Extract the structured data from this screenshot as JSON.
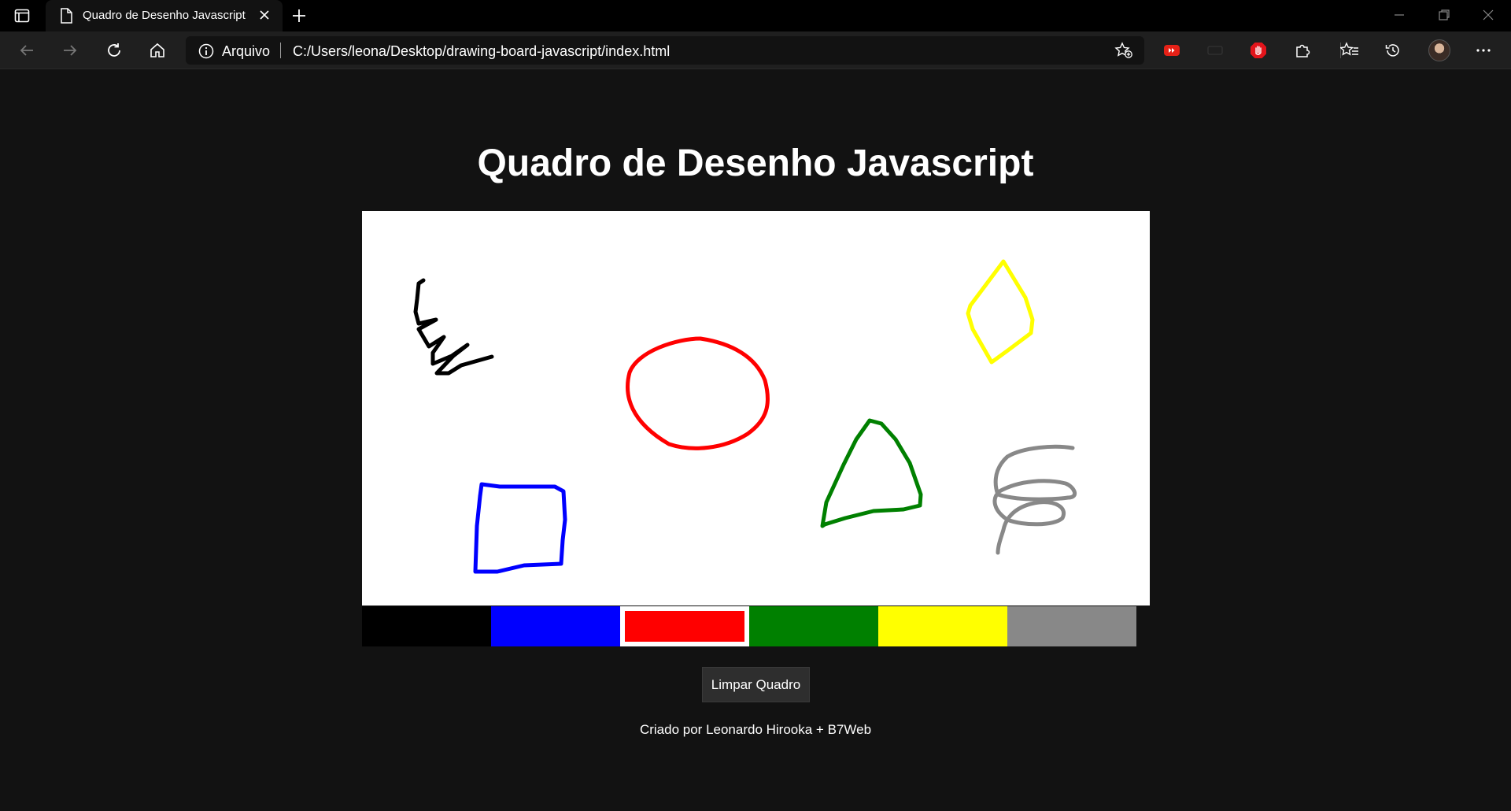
{
  "browser": {
    "tab_title": "Quadro de Desenho Javascript",
    "address_scheme": "Arquivo",
    "address_url": "C:/Users/leona/Desktop/drawing-board-javascript/index.html"
  },
  "page": {
    "title": "Quadro de Desenho Javascript",
    "clear_button": "Limpar Quadro",
    "credits": "Criado por Leonardo Hirooka + B7Web"
  },
  "palette": {
    "colors": [
      "#000000",
      "#0000ff",
      "#ff0000",
      "#008000",
      "#ffff00",
      "#888888"
    ],
    "selected": "#ff0000"
  },
  "drawing": {
    "strokes": [
      {
        "shape": "zigzag",
        "color": "#000000"
      },
      {
        "shape": "circle",
        "color": "#ff0000"
      },
      {
        "shape": "diamond",
        "color": "#ffff00"
      },
      {
        "shape": "square",
        "color": "#0000ff"
      },
      {
        "shape": "triangle",
        "color": "#008000"
      },
      {
        "shape": "spiral",
        "color": "#888888"
      }
    ]
  }
}
